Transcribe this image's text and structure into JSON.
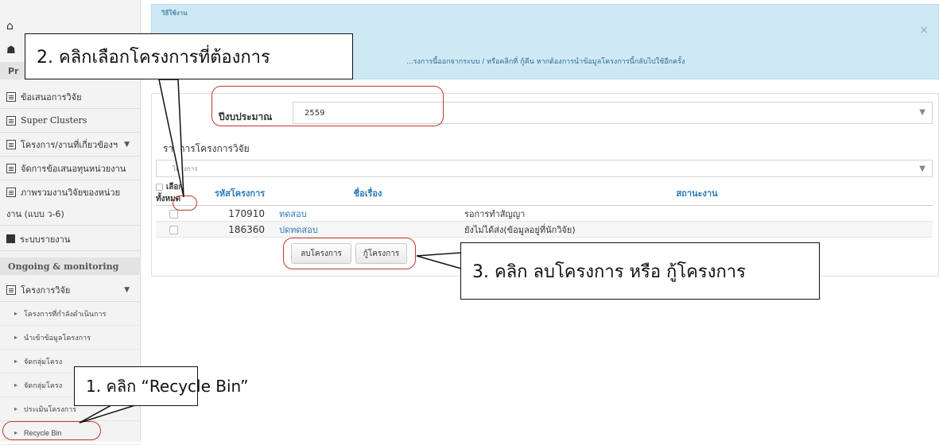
{
  "sidebar": {
    "home_partial": "⌂",
    "profile_partial": "☗",
    "section_research": "Pr",
    "items": [
      {
        "label": "ข้อเสนอการวิจัย"
      },
      {
        "label": "Super Clusters"
      },
      {
        "label": "โครงการ/งานที่เกี่ยวข้องฯ"
      },
      {
        "label": "จัดการข้อเสนอทุนหน่วยงาน"
      },
      {
        "label": "ภาพรวมงานวิจัยของหน่วย"
      },
      {
        "label": "งาน (แบบ ว-6)"
      },
      {
        "label": "ระบบรายงาน"
      }
    ],
    "section_ongoing": "Ongoing & monitoring",
    "research_projects": "โครงการวิจัย",
    "subitems": [
      {
        "label": "โครงการที่กำลังดำเนินการ"
      },
      {
        "label": "นำเข้าข้อมูลโครงการ"
      },
      {
        "label": "จัดกลุ่มโครง"
      },
      {
        "label": "จัดกลุ่มโครง"
      },
      {
        "label": "ประเมินโครงการ"
      },
      {
        "label": "Recycle Bin"
      }
    ]
  },
  "alert": {
    "title_partial": "วิธีใช้งาน",
    "text": "...รงการนี้ออกจากระบบ / หรือคลิกที่ กู้คืน หากต้องการนำข้อมูลโครงการนี้กลับไปใช้อีกครั้ง",
    "close": "×"
  },
  "form": {
    "year_label": "ปีงบประมาณ",
    "year_value": "2559",
    "list_title": "รายการโครงการวิจัย",
    "filter_placeholder": "โครงการ"
  },
  "table": {
    "headers": {
      "select_all": "เลือกทั้งหมด",
      "code": "รหัสโครงการ",
      "title": "ชื่อเรื่อง",
      "status": "สถานะงาน"
    },
    "rows": [
      {
        "code": "170910",
        "title": "ทดสอบ",
        "status": "รอการทำสัญญา"
      },
      {
        "code": "186360",
        "title": "ปดทดสอบ",
        "status": "ยังไม่ได้ส่ง(ข้อมูลอยู่ที่นักวิจัย)"
      }
    ]
  },
  "buttons": {
    "delete": "ลบโครงการ",
    "restore": "กู้โครงการ"
  },
  "annotations": {
    "step1": "1. คลิก “Recycle Bin”",
    "step2": "2. คลิกเลือกโครงการที่ต้องการ",
    "step3": "3. คลิก ลบโครงการ หรือ กู้โครงการ"
  },
  "colors": {
    "accent_link": "#2a7ab8",
    "alert_bg": "#cfe9f4",
    "highlight": "#c0392b"
  }
}
